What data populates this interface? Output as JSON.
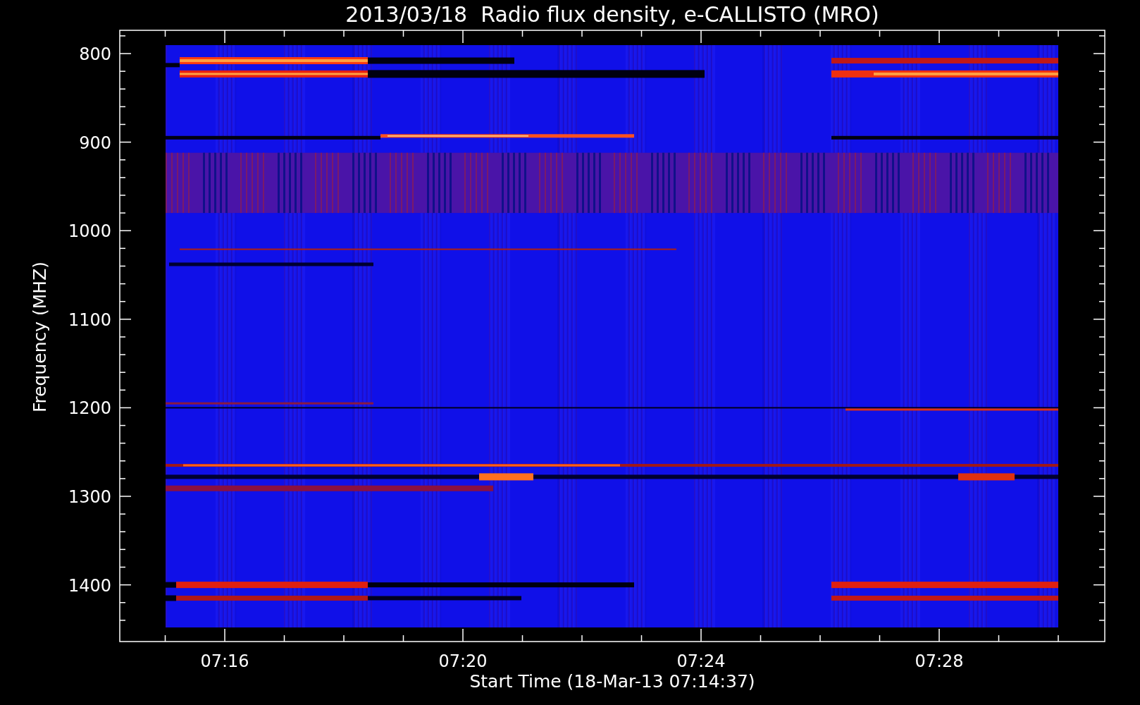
{
  "title": "2013/03/18  Radio flux density, e-CALLISTO (MRO)",
  "plot": {
    "ylabel": "Frequency (MHZ)",
    "xlabel": "Start Time (18-Mar-13 07:14:37)",
    "yticks": [
      "800",
      "900",
      "1000",
      "1100",
      "1200",
      "1300",
      "1400"
    ],
    "xticks": [
      "07:16",
      "07:20",
      "07:24",
      "07:28"
    ]
  }
}
